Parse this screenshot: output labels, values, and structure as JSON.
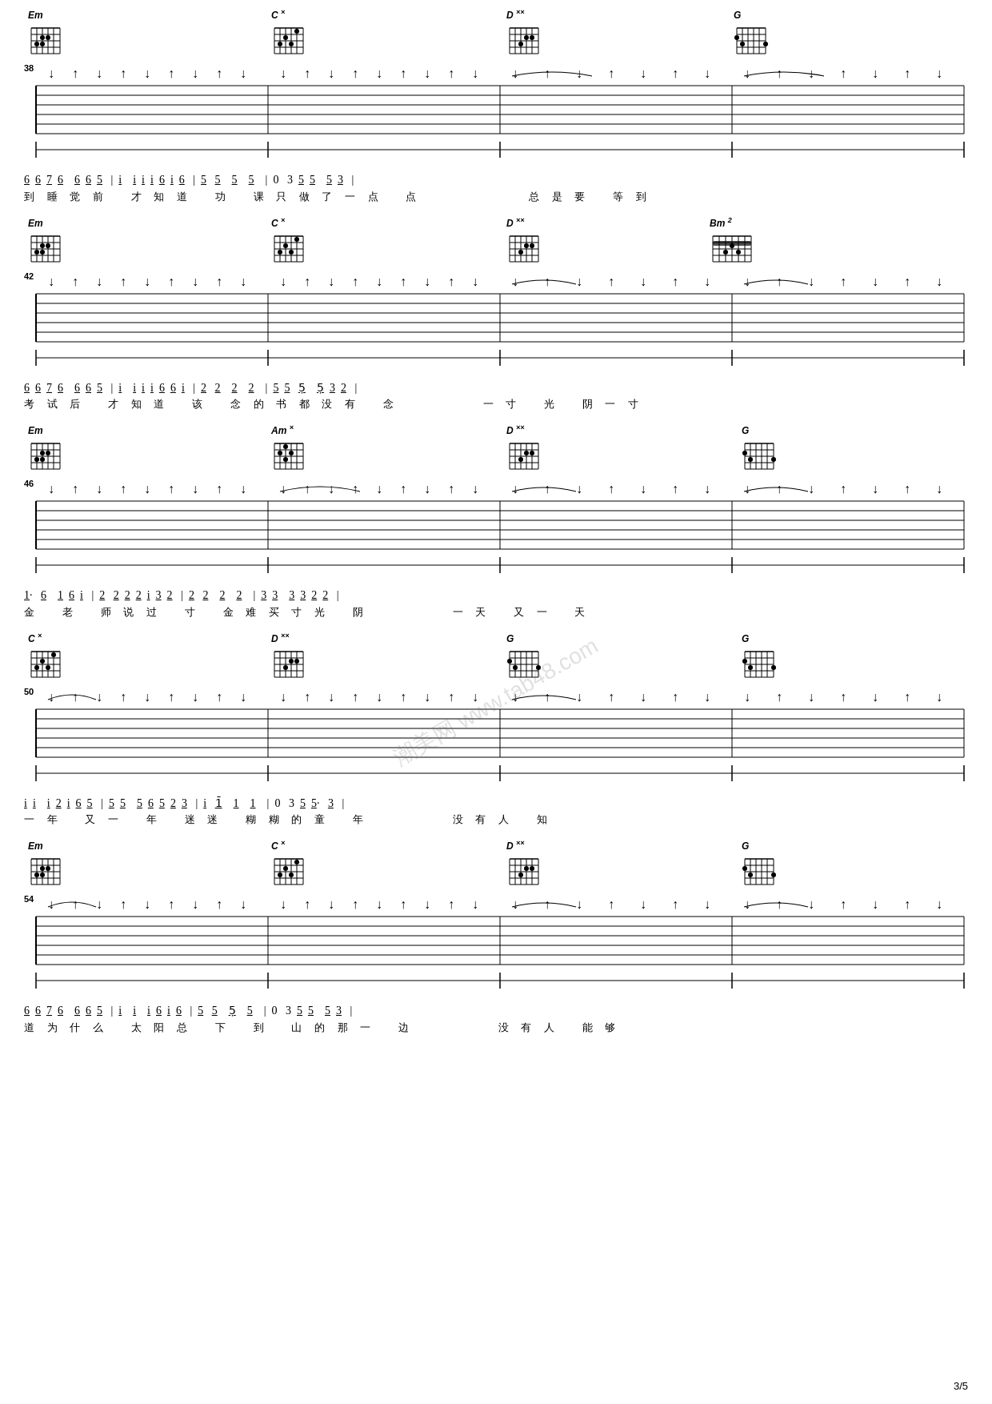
{
  "page": {
    "number": "3/5",
    "watermark": "潮美网 www.tab48.com"
  },
  "sections": [
    {
      "id": "section-38",
      "measure_num": "38",
      "chords": [
        {
          "name": "Em",
          "position": 0,
          "fret_marker": ""
        },
        {
          "name": "C",
          "position": 1,
          "fret_marker": "×"
        },
        {
          "name": "D",
          "position": 2,
          "fret_marker": "××"
        },
        {
          "name": "G",
          "position": 3,
          "fret_marker": ""
        }
      ],
      "notation": "6 6 7 6   6 6 5 | i   i i i 6 i 6 | 5  5   5   5  | 0  3 5 5   5 3 |",
      "lyrics": "到 睡 觉 前   才 知 道   功   课 只 做 了 一 点   点               总 是 要   等 到"
    },
    {
      "id": "section-42",
      "measure_num": "42",
      "chords": [
        {
          "name": "Em",
          "position": 0,
          "fret_marker": ""
        },
        {
          "name": "C",
          "position": 1,
          "fret_marker": "×"
        },
        {
          "name": "D",
          "position": 2,
          "fret_marker": "××"
        },
        {
          "name": "Bm",
          "position": 3,
          "fret_marker": "2"
        }
      ],
      "notation": "6 6 7 6   6 6 5 | i   i i i 6 6 i | 2  2   2   2  | 5 5  5̣   5̣ 3 2 |",
      "lyrics": "考 试 后   才 知 道   该   念 的 书 都 没 有   念               一 寸   光   阴 一 寸"
    },
    {
      "id": "section-46",
      "measure_num": "46",
      "chords": [
        {
          "name": "Em",
          "position": 0,
          "fret_marker": ""
        },
        {
          "name": "Am",
          "position": 1,
          "fret_marker": "×"
        },
        {
          "name": "D",
          "position": 2,
          "fret_marker": "××"
        },
        {
          "name": "G",
          "position": 3,
          "fret_marker": ""
        }
      ],
      "notation": "1·  6   1 6 i | 2  2 2 2 i 3 2 | 2  2   2   2  | 3 3   3 3 2 2 |",
      "lyrics": "金   老   师 说 过   寸   金 难 买 寸 光   阴               一 天   又 一   天"
    },
    {
      "id": "section-50",
      "measure_num": "50",
      "chords": [
        {
          "name": "C",
          "position": 0,
          "fret_marker": "×"
        },
        {
          "name": "D",
          "position": 1,
          "fret_marker": "××"
        },
        {
          "name": "G",
          "position": 2,
          "fret_marker": ""
        },
        {
          "name": "G",
          "position": 3,
          "fret_marker": ""
        }
      ],
      "notation": "i i   i 2 i 6 5 | 5 5   5 6 5 2 3 | i  1̄   1   1  | 0  3 5 5·  3 |",
      "lyrics": "一 年   又 一   年   迷 迷   糊 糊 的 童   年               没 有 人   知"
    },
    {
      "id": "section-54",
      "measure_num": "54",
      "chords": [
        {
          "name": "Em",
          "position": 0,
          "fret_marker": ""
        },
        {
          "name": "C",
          "position": 1,
          "fret_marker": "×"
        },
        {
          "name": "D",
          "position": 2,
          "fret_marker": "××"
        },
        {
          "name": "G",
          "position": 3,
          "fret_marker": ""
        }
      ],
      "notation": "6 6 7 6   6 6 5 | i   i   i 6 i 6 | 5  5   5̣   5  | 0  3 5 5   5 3 |",
      "lyrics": "道 为 什 么   太 阳 总   下   到   山 的 那 一   边               没 有 人   能 够"
    }
  ]
}
